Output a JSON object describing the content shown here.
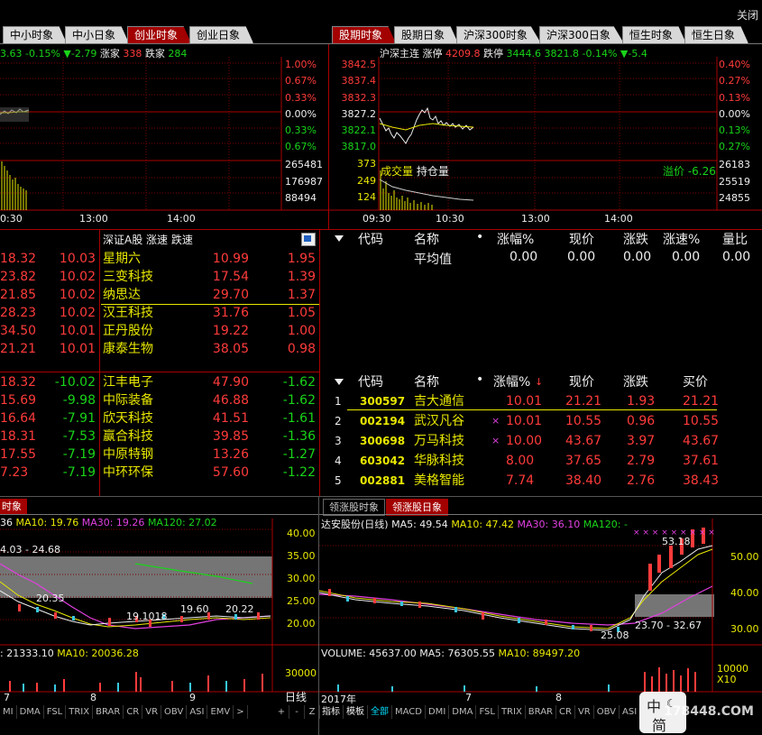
{
  "window": {
    "close_label": "关闭"
  },
  "left_tabs": [
    "中小时象",
    "中小日象",
    "创业时象",
    "创业日象"
  ],
  "left_active_tab": 2,
  "right_tabs": [
    "股期时象",
    "股期日象",
    "沪深300时象",
    "沪深300日象",
    "恒生时象",
    "恒生日象"
  ],
  "right_active_tab": 0,
  "left_intraday": {
    "info": {
      "price_frag": "3.63",
      "pct": "-0.15%",
      "chg": "▼-2.79",
      "up_label": "涨家",
      "up_count": "338",
      "down_label": "跌家",
      "down_count": "284"
    },
    "pct_axis": [
      "1.00%",
      "0.67%",
      "0.33%",
      "0.00%",
      "0.33%",
      "0.67%"
    ],
    "vol_axis": [
      "265481",
      "176987",
      "88494"
    ],
    "time_axis": [
      "0:30",
      "13:00",
      "14:00"
    ]
  },
  "right_intraday": {
    "info": {
      "title": "沪深主连",
      "up_label": "涨停",
      "up_val": "4209.8",
      "down_label": "跌停",
      "down_val": "3444.6",
      "price": "3821.8",
      "pct": "-0.14%",
      "chg": "▼-5.4"
    },
    "price_axis": [
      "3842.5",
      "3837.4",
      "3832.3",
      "3827.2",
      "3822.1",
      "3817.0"
    ],
    "vol_axis": [
      "373",
      "249",
      "124"
    ],
    "vol_legend": "成交量",
    "oi_legend": "持仓量",
    "basis": "溢价 -6.26",
    "pct_axis": [
      "0.40%",
      "0.27%",
      "0.13%",
      "0.00%",
      "0.13%",
      "0.27%"
    ],
    "oi_axis": [
      "26183",
      "25519",
      "24855"
    ],
    "time_axis": [
      "09:30",
      "10:30",
      "13:00",
      "14:00"
    ]
  },
  "speed_panel": {
    "header": "深证A股 涨速 跌速",
    "left_top": [
      [
        "18.32",
        "10.03"
      ],
      [
        "23.82",
        "10.02"
      ],
      [
        "21.85",
        "10.02"
      ],
      [
        "28.23",
        "10.02"
      ],
      [
        "34.50",
        "10.01"
      ],
      [
        "21.21",
        "10.01"
      ]
    ],
    "top": [
      {
        "name": "星期六",
        "price": "10.99",
        "speed": "1.95"
      },
      {
        "name": "三变科技",
        "price": "17.54",
        "speed": "1.39"
      },
      {
        "name": "纳思达",
        "price": "29.70",
        "speed": "1.37"
      },
      {
        "name": "汉王科技",
        "price": "31.76",
        "speed": "1.05"
      },
      {
        "name": "正丹股份",
        "price": "19.22",
        "speed": "1.00"
      },
      {
        "name": "康泰生物",
        "price": "38.05",
        "speed": "0.98"
      }
    ],
    "left_bottom": [
      [
        "18.32",
        "-10.02"
      ],
      [
        "15.69",
        "-9.98"
      ],
      [
        "16.64",
        "-7.91"
      ],
      [
        "18.31",
        "-7.53"
      ],
      [
        "17.55",
        "-7.19"
      ],
      [
        "7.23",
        "-7.19"
      ]
    ],
    "bottom": [
      {
        "name": "江丰电子",
        "price": "47.90",
        "speed": "-1.62"
      },
      {
        "name": "中际装备",
        "price": "46.88",
        "speed": "-1.62"
      },
      {
        "name": "欣天科技",
        "price": "41.51",
        "speed": "-1.61"
      },
      {
        "name": "赢合科技",
        "price": "39.85",
        "speed": "-1.36"
      },
      {
        "name": "中原特钢",
        "price": "13.26",
        "speed": "-1.27"
      },
      {
        "name": "中环环保",
        "price": "57.60",
        "speed": "-1.22"
      }
    ]
  },
  "avg_table": {
    "headers": [
      "代码",
      "名称",
      "涨幅%",
      "现价",
      "涨跌",
      "涨速%",
      "量比"
    ],
    "row": {
      "label": "平均值",
      "pct": "0.00",
      "price": "0.00",
      "chg": "0.00",
      "speed": "0.00",
      "vr": "0.00"
    }
  },
  "leader_table": {
    "headers": [
      "代码",
      "名称",
      "涨幅%",
      "现价",
      "涨跌",
      "买价"
    ],
    "rows": [
      {
        "no": "1",
        "code": "300597",
        "name": "吉大通信",
        "mark": "",
        "pct": "10.01",
        "price": "21.21",
        "chg": "1.93",
        "bid": "21.21"
      },
      {
        "no": "2",
        "code": "002194",
        "name": "武汉凡谷",
        "mark": "×",
        "pct": "10.01",
        "price": "10.55",
        "chg": "0.96",
        "bid": "10.55"
      },
      {
        "no": "3",
        "code": "300698",
        "name": "万马科技",
        "mark": "×",
        "pct": "10.00",
        "price": "43.67",
        "chg": "3.97",
        "bid": "43.67"
      },
      {
        "no": "4",
        "code": "603042",
        "name": "华脉科技",
        "mark": "",
        "pct": "8.00",
        "price": "37.65",
        "chg": "2.79",
        "bid": "37.61"
      },
      {
        "no": "5",
        "code": "002881",
        "name": "美格智能",
        "mark": "",
        "pct": "7.74",
        "price": "38.40",
        "chg": "2.76",
        "bid": "38.43"
      }
    ]
  },
  "bottom_left": {
    "tab": "时象",
    "ma": {
      "ma5frag": "36",
      "ma10": "MA10: 19.76",
      "ma30": "MA30: 19.26",
      "ma120": "MA120: 27.02"
    },
    "range_note": "4.03 - 24.68",
    "price_axis": [
      "40.00",
      "35.00",
      "30.00",
      "25.00",
      "20.00"
    ],
    "notes": [
      "20.35",
      "19.60",
      "20.22",
      "19.1018"
    ],
    "vol_info": {
      "a": ": 21333.10",
      "b": "MA10: 20036.28"
    },
    "vol_axis": "30000",
    "time_labels": [
      "7",
      "8",
      "9"
    ],
    "period": "日线",
    "nav": [
      "+",
      "-",
      "Z"
    ],
    "indicators": [
      "MI",
      "DMA",
      "FSL",
      "TRIX",
      "BRAR",
      "CR",
      "VR",
      "OBV",
      "ASI",
      "EMV",
      ">"
    ]
  },
  "bottom_right": {
    "tabs": [
      "领涨股时象",
      "领涨股日象"
    ],
    "active_tab": 1,
    "ma": {
      "title": "达安股份(日线)",
      "ma5": "MA5: 49.54",
      "ma10": "MA10: 47.42",
      "ma30": "MA30: 36.10",
      "ma120": "MA120: -"
    },
    "price_axis": [
      "50.00",
      "40.00",
      "30.00"
    ],
    "notes": {
      "high": "53.18",
      "range": "23.70 - 32.67",
      "low": "25.08"
    },
    "vol_info": {
      "v": "VOLUME: 45637.00",
      "ma5": "MA5: 76305.55",
      "ma10": "MA10: 89497.20"
    },
    "vol_axis": [
      "10000",
      "X10"
    ],
    "time_labels": [
      "2017年",
      "7",
      "8"
    ],
    "indicators": [
      "指标",
      "模板",
      "全部",
      "MACD",
      "DMI",
      "DMA",
      "FSL",
      "TRIX",
      "BRAR",
      "CR",
      "VR",
      "OBV",
      "ASI"
    ],
    "active_indicator": 2,
    "ime": {
      "a": "中",
      "b": "简"
    },
    "watermark": "178448.COM"
  }
}
